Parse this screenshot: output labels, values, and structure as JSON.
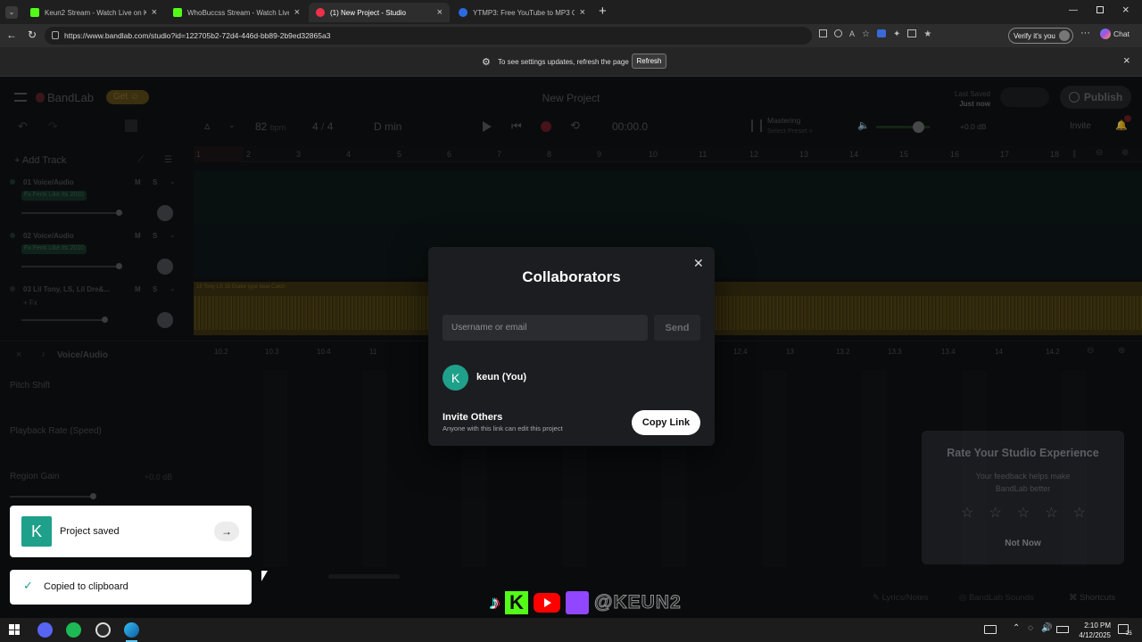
{
  "browser": {
    "tabs": [
      {
        "title": "Keun2 Stream - Watch Live on Kick",
        "active": false,
        "favicon_color": "#53fc18"
      },
      {
        "title": "WhoBuccss Stream - Watch Live on",
        "active": false,
        "favicon_color": "#53fc18"
      },
      {
        "title": "(1) New Project - Studio",
        "active": true,
        "favicon_color": "#f0304a"
      },
      {
        "title": "YTMP3: Free YouTube to MP3 Conv",
        "active": false,
        "favicon_color": "#2a6ce0"
      }
    ],
    "new_tab": "+",
    "url": "https://www.bandlab.com/studio?id=122705b2-72d4-446d-bb89-2b9ed32865a3",
    "verify_label": "Verify it's you",
    "chat_label": "Chat",
    "info_message": "To see settings updates, refresh the page",
    "refresh_label": "Refresh"
  },
  "app": {
    "brand": "BandLab",
    "get_label": "Get",
    "project_title": "New Project",
    "last_saved_label": "Last Saved",
    "last_saved_value": "Just now",
    "publish_label": "Publish",
    "invite_label": "Invite",
    "tempo": "82",
    "tempo_unit": "bpm",
    "time_sig_top": "4",
    "time_sig_bottom": "4",
    "key": "D min",
    "time": "00:00.0",
    "mastering_label": "Mastering",
    "mastering_sub": "Select Preset >",
    "volume_db": "+0.0 dB",
    "add_track": "Add Track",
    "tracks": [
      {
        "name": "01 Voice/Audio",
        "fx": "Fx Fenti Like Its 2010"
      },
      {
        "name": "02 Voice/Audio",
        "fx": "Fx Fenti Like Its 2010"
      },
      {
        "name": "03 Lil Tony, LS, Lil Dre&...",
        "fx": "+ Fx"
      }
    ],
    "region_label": "18 Tony LS 18 Drake type beat Catch",
    "ruler": [
      "1",
      "2",
      "3",
      "4",
      "5",
      "6",
      "7",
      "8",
      "9",
      "10",
      "11",
      "12",
      "13",
      "14",
      "15",
      "16",
      "17",
      "18"
    ],
    "lower_ruler": [
      "10.2",
      "10.3",
      "10.4",
      "11",
      "12.4",
      "13",
      "13.2",
      "13.3",
      "13.4",
      "14",
      "14.2"
    ],
    "editor_title": "Voice/Audio",
    "pitch_shift": "Pitch Shift",
    "playback_rate": "Playback Rate (Speed)",
    "region_gain": "Region Gain",
    "region_gain_value": "+0.0 dB",
    "bottom_links": [
      "Lyrics/Notes",
      "BandLab Sounds",
      "Shortcuts"
    ],
    "social_text": "@KEUN2"
  },
  "modal": {
    "title": "Collaborators",
    "input_placeholder": "Username or email",
    "send_label": "Send",
    "avatar_letter": "K",
    "collaborator": "keun (You)",
    "invite_title": "Invite Others",
    "invite_sub": "Anyone with this link can edit this project",
    "copy_link": "Copy Link"
  },
  "toasts": {
    "saved_letter": "K",
    "saved": "Project saved",
    "copied": "Copied to clipboard"
  },
  "rate": {
    "title": "Rate Your Studio Experience",
    "sub": "Your feedback helps make BandLab better",
    "not_now": "Not Now",
    "stars": 5
  },
  "taskbar": {
    "time": "2:10 PM",
    "date": "4/12/2025",
    "notif_count": "25"
  }
}
